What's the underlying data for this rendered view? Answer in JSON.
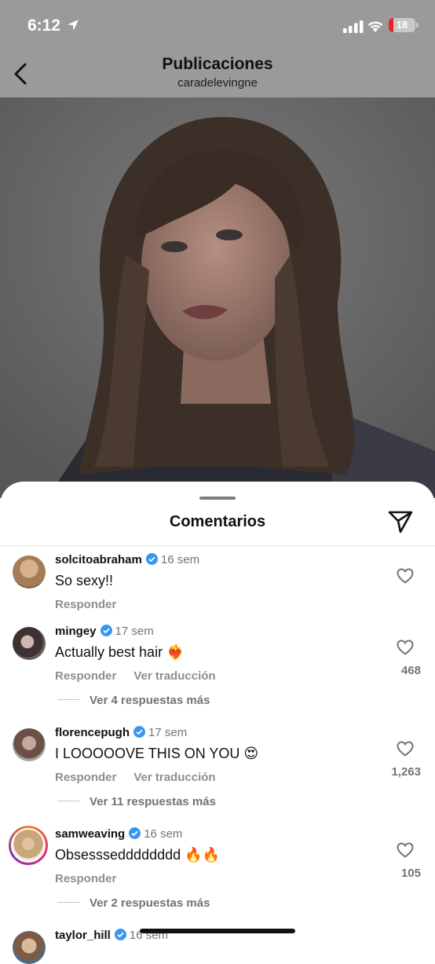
{
  "status_bar": {
    "time": "6:12",
    "battery": "18",
    "battery_level": 0.18
  },
  "nav": {
    "title": "Publicaciones",
    "subtitle": "caradelevingne"
  },
  "sheet": {
    "title": "Comentarios"
  },
  "comments": [
    {
      "user": "solcitoabraham",
      "time": "16 sem",
      "text": "So sexy!!",
      "reply": "Responder",
      "translate": "",
      "likes": "",
      "more_replies": ""
    },
    {
      "user": "mingey",
      "time": "17 sem",
      "text": "Actually best hair ❤️‍🔥",
      "reply": "Responder",
      "translate": "Ver traducción",
      "likes": "468",
      "more_replies": "Ver 4 respuestas más"
    },
    {
      "user": "florencepugh",
      "time": "17 sem",
      "text": "I LOOOOOVE THIS ON YOU 😍",
      "reply": "Responder",
      "translate": "Ver traducción",
      "likes": "1,263",
      "more_replies": "Ver 11 respuestas más"
    },
    {
      "user": "samweaving",
      "time": "16 sem",
      "text": "Obsesssedddddddd 🔥🔥",
      "reply": "Responder",
      "translate": "",
      "likes": "105",
      "more_replies": "Ver 2 respuestas más"
    },
    {
      "user": "taylor_hill",
      "time": "16 sem"
    }
  ],
  "colors": {
    "verified": "#3897f0",
    "secondary_text": "#737373",
    "header_bg": "#9a9a9a"
  }
}
